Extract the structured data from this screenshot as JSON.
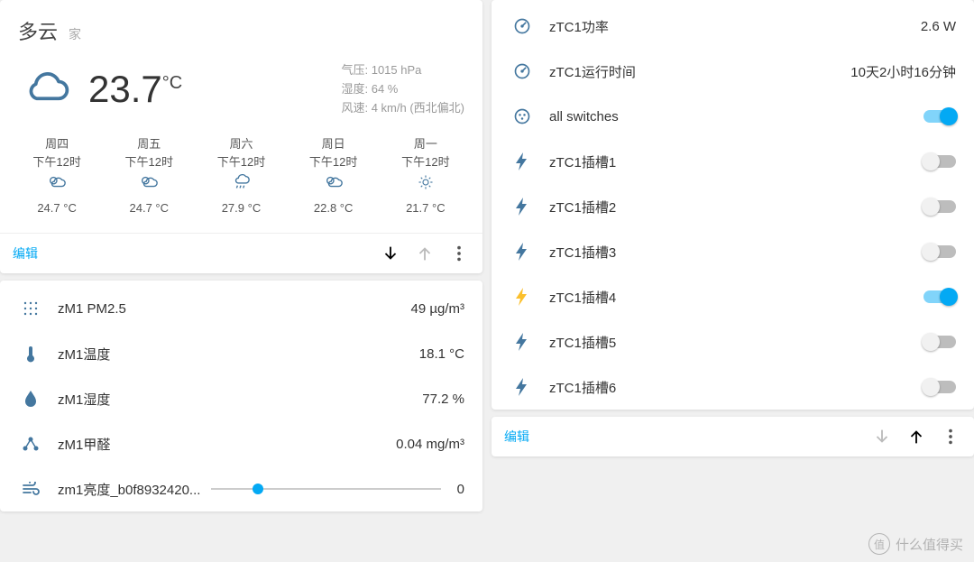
{
  "weather": {
    "condition": "多云",
    "location": "家",
    "temp": "23.7",
    "temp_unit": "°C",
    "pressure_label": "气压: 1015 hPa",
    "humidity_label": "湿度: 64 %",
    "wind_label": "风速: 4 km/h (西北偏北)",
    "forecast": [
      {
        "day": "周四",
        "time": "下午12时",
        "temp": "24.7 °C"
      },
      {
        "day": "周五",
        "time": "下午12时",
        "temp": "24.7 °C"
      },
      {
        "day": "周六",
        "time": "下午12时",
        "temp": "27.9 °C"
      },
      {
        "day": "周日",
        "time": "下午12时",
        "temp": "22.8 °C"
      },
      {
        "day": "周一",
        "time": "下午12时",
        "temp": "21.7 °C"
      }
    ],
    "edit": "编辑"
  },
  "sensors": {
    "items": [
      {
        "label": "zM1 PM2.5",
        "value": "49 µg/m³",
        "icon": "dots"
      },
      {
        "label": "zM1温度",
        "value": "18.1 °C",
        "icon": "thermo"
      },
      {
        "label": "zM1湿度",
        "value": "77.2 %",
        "icon": "drop"
      },
      {
        "label": "zM1甲醛",
        "value": "0.04 mg/m³",
        "icon": "molecule"
      },
      {
        "label": "zm1亮度_b0f8932420...",
        "value": "0",
        "icon": "wind",
        "slider": true
      }
    ]
  },
  "power": {
    "gauge1": {
      "label": "zTC1功率",
      "value": "2.6 W"
    },
    "gauge2": {
      "label": "zTC1运行时间",
      "value": "10天2小时16分钟"
    },
    "group": {
      "label": "all switches",
      "on": true
    },
    "switches": [
      {
        "label": "zTC1插槽1",
        "on": false
      },
      {
        "label": "zTC1插槽2",
        "on": false
      },
      {
        "label": "zTC1插槽3",
        "on": false
      },
      {
        "label": "zTC1插槽4",
        "on": true
      },
      {
        "label": "zTC1插槽5",
        "on": false
      },
      {
        "label": "zTC1插槽6",
        "on": false
      }
    ],
    "edit": "编辑"
  },
  "watermark": "什么值得买"
}
